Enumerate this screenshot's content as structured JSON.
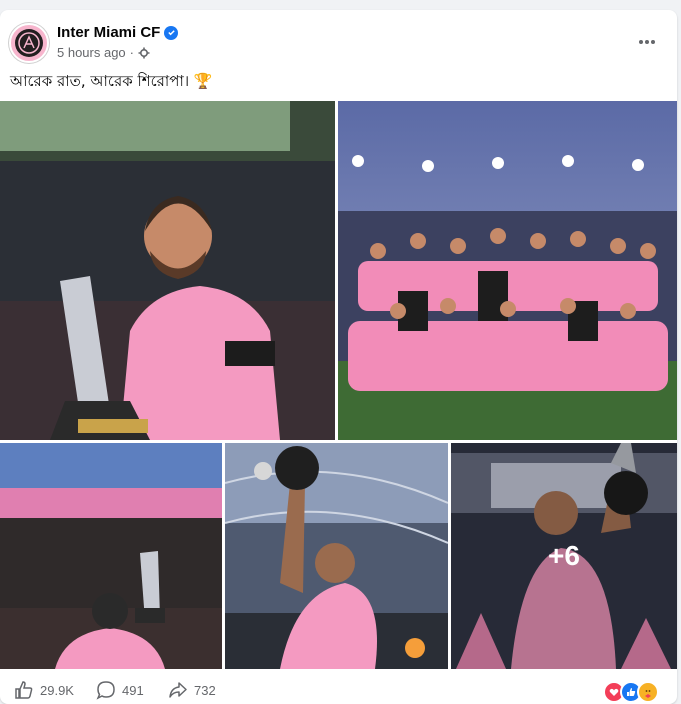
{
  "post": {
    "author": "Inter Miami CF",
    "time": "5 hours ago",
    "caption": "আরেক রাত, আরেক শিরোপা। 🏆",
    "extra_photos": "+6"
  },
  "photos": [
    {
      "label": "player-with-trophy"
    },
    {
      "label": "team-celebration"
    },
    {
      "label": "trophy-raised-stadium"
    },
    {
      "label": "player-raising-trophy"
    },
    {
      "label": "player-with-trophy-crowd"
    }
  ],
  "stats": {
    "likes": "29.9K",
    "comments": "491",
    "shares": "732"
  },
  "colors": {
    "brand_pink": "#f7b5cd",
    "facebook_blue": "#1877f2"
  }
}
